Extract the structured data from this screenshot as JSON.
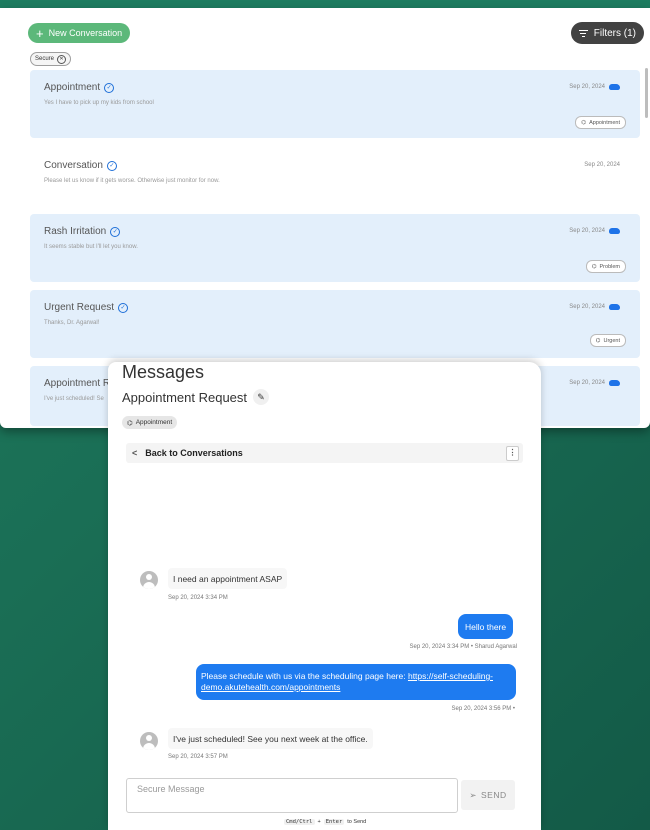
{
  "list": {
    "new_button": "New Conversation",
    "filters_button": "Filters (1)",
    "filter_chip": "Secure",
    "conversations": [
      {
        "title": "Appointment",
        "preview": "Yes I have to pick up my kids from school",
        "date": "Sep 20, 2024",
        "tag": "Appointment",
        "synced": true
      },
      {
        "title": "Conversation",
        "preview": "Please let us know if it gets worse. Otherwise just monitor for now.",
        "date": "Sep 20, 2024",
        "tag": "",
        "synced": false
      },
      {
        "title": "Rash Irritation",
        "preview": "It seems stable but I'll let you know.",
        "date": "Sep 20, 2024",
        "tag": "Problem",
        "synced": true
      },
      {
        "title": "Urgent Request",
        "preview": "Thanks, Dr. Agarwal!",
        "date": "Sep 20, 2024",
        "tag": "Urgent",
        "synced": true
      },
      {
        "title": "Appointment Res",
        "preview": "I've just scheduled! Se",
        "date": "Sep 20, 2024",
        "tag": "",
        "synced": true
      }
    ]
  },
  "messages": {
    "heading": "Messages",
    "conversation_title": "Appointment Request",
    "tag": "Appointment",
    "back_label": "Back to Conversations",
    "items": [
      {
        "direction": "in",
        "text": "I need an appointment ASAP",
        "meta": "Sep 20, 2024 3:34 PM"
      },
      {
        "direction": "out",
        "text": "Hello there",
        "meta": "Sep 20, 2024 3:34 PM • Sharud Agarwal"
      },
      {
        "direction": "out",
        "text": "Please schedule with us via the scheduling page here: ",
        "link": "https://self-scheduling-demo.akutehealth.com/appointments",
        "meta": "Sep 20, 2024 3:56 PM •"
      },
      {
        "direction": "in",
        "text": "I've just scheduled! See you next week at the office.",
        "meta": "Sep 20, 2024 3:57 PM"
      }
    ],
    "input_placeholder": "Secure Message",
    "send_label": "SEND",
    "hint": {
      "key1": "Cmd/Ctrl",
      "plus": "+",
      "key2": "Enter",
      "suffix": "to Send"
    }
  },
  "colors": {
    "accent_green": "#5cb87a",
    "bubble_blue": "#1e7bf0",
    "list_highlight": "#e3effb",
    "background": "#1a6e55"
  },
  "icons": [
    "plus-icon",
    "filter-icon",
    "close-circle-icon",
    "verified-check-icon",
    "cloud-sync-icon",
    "tag-icon",
    "edit-pencil-icon",
    "chevron-left-icon",
    "more-vert-icon",
    "avatar-icon",
    "send-icon"
  ]
}
